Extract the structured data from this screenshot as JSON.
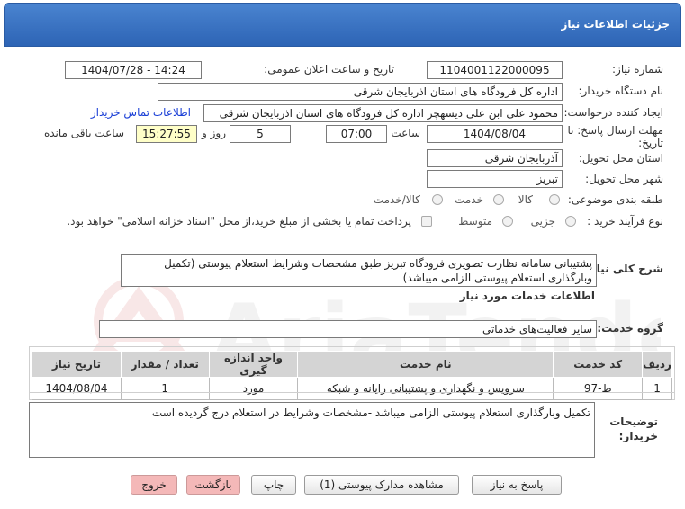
{
  "header": {
    "title": "جزئیات اطلاعات نیاز"
  },
  "fields": {
    "need_number_label": "شماره نیاز:",
    "need_number": "1104001122000095",
    "announce_label": "تاریخ و ساعت اعلان عمومی:",
    "announce_value": "1404/07/28 - 14:24",
    "buyer_org_label": "نام دستگاه خریدار:",
    "buyer_org": "اداره کل فرودگاه های استان اذربایجان شرقی",
    "requester_label": "ایجاد کننده درخواست:",
    "requester": "محمود علی ابن علی دیسهچر اداره کل فرودگاه های استان اذربایجان شرقی",
    "contact_link": "اطلاعات تماس خریدار",
    "deadline_label_1": "مهلت ارسال پاسخ: تا",
    "deadline_label_2": "تاریخ:",
    "deadline_date": "1404/08/04",
    "time_label": "ساعت",
    "deadline_time": "07:00",
    "days_value": "5",
    "days_label": "روز و",
    "remaining_time": "15:27:55",
    "remaining_label": "ساعت باقی مانده",
    "province_label": "استان محل تحویل:",
    "province": "آذربایجان شرقی",
    "city_label": "شهر محل تحویل:",
    "city": "تبریز",
    "category_label": "طبقه بندی موضوعی:",
    "category_options": [
      "کالا",
      "خدمت",
      "کالا/خدمت"
    ],
    "process_label": "نوع فرآیند خرید :",
    "process_options": [
      "جزیی",
      "متوسط"
    ],
    "treasury_note": "پرداخت تمام یا بخشی از مبلغ خرید،از محل \"اسناد خزانه اسلامی\" خواهد بود."
  },
  "description": {
    "label": "شرح کلی نیاز:",
    "text": "پشتیبانی سامانه نظارت تصویری فرودگاه تبریز طبق مشخصات وشرایط استعلام پیوستی (تکمیل وبارگذاری استعلام پیوستی الزامی میباشد)"
  },
  "services": {
    "section_title": "اطلاعات خدمات مورد نیاز",
    "group_label": "گروه خدمت:",
    "group_value": "سایر فعالیت‌های خدماتی",
    "columns": [
      "ردیف",
      "کد خدمت",
      "نام خدمت",
      "واحد اندازه گیری",
      "تعداد / مقدار",
      "تاریخ نیاز"
    ],
    "rows": [
      [
        "1",
        "ط-97",
        "سرویس و نگهداری و پشتیبانی رایانه و شبکه",
        "مورد",
        "1",
        "1404/08/04"
      ]
    ]
  },
  "buyer_notes": {
    "label_1": "توضیحات",
    "label_2": "خریدار:",
    "text": "تکمیل وبارگذاری استعلام پیوستی الزامی میباشد -مشخصات وشرایط در استعلام درج گردیده است"
  },
  "buttons": {
    "reply": "پاسخ به نیاز",
    "attachments": "مشاهده مدارک پیوستی (1)",
    "print": "چاپ",
    "back": "بازگشت",
    "exit": "خروج"
  },
  "watermark": "AriaTender.net",
  "colors": {
    "header": "#2d64b5",
    "highlight": "#ffffc8",
    "link": "#1a3fd6",
    "exit_button": "#f4b8b8"
  }
}
